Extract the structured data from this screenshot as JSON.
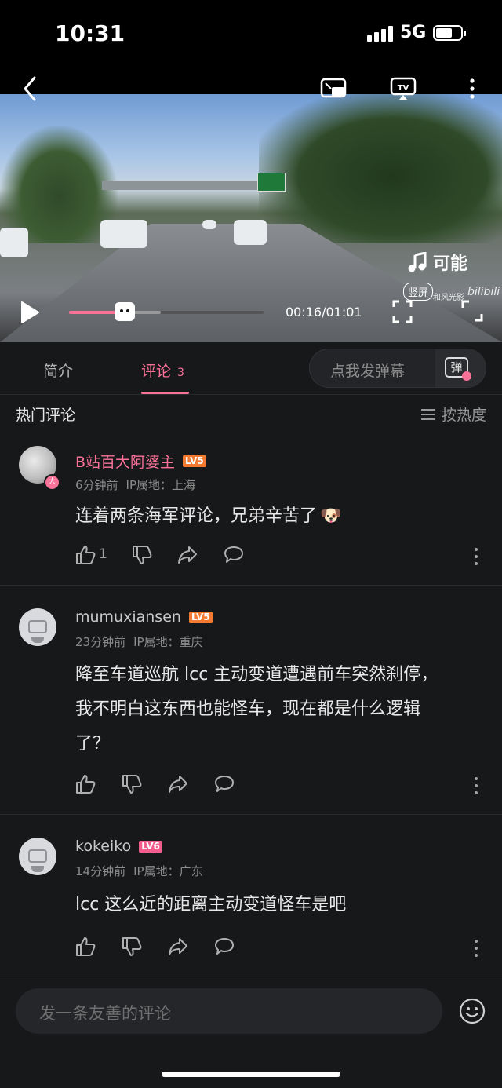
{
  "status_bar": {
    "time": "10:31",
    "network": "5G"
  },
  "video": {
    "music_label": "可能",
    "vertical_label": "竖屏",
    "watermark": "和风光影",
    "watermark_logo": "bilibili",
    "timecode": "00:16/01:01",
    "progress_fraction": 0.24,
    "buffer_fraction": 0.47
  },
  "tabs": {
    "intro_label": "简介",
    "comments_label": "评论",
    "comments_count": "3",
    "danmaku_placeholder": "点我发弹幕",
    "danmaku_icon_label": "弹"
  },
  "section": {
    "title": "热门评论",
    "sort_label": "按热度"
  },
  "comments": [
    {
      "username": "B站百大阿婆主",
      "level": "LV5",
      "time": "6分钟前",
      "ip": "IP属地：上海",
      "text": "连着两条海军评论，兄弟辛苦了",
      "emoji": "🐶",
      "like_count": "1",
      "badge": "大"
    },
    {
      "username": "mumuxiansen",
      "level": "LV5",
      "time": "23分钟前",
      "ip": "IP属地：重庆",
      "text_lines": [
        "降至车道巡航 lcc 主动变道遭遇前车突然刹停，",
        "我不明白这东西也能怪车，现在都是什么逻辑",
        "了？"
      ]
    },
    {
      "username": "kokeiko",
      "level": "LV6",
      "time": "14分钟前",
      "ip": "IP属地：广东",
      "text": "lcc 这么近的距离主动变道怪车是吧"
    }
  ],
  "composer": {
    "placeholder": "发一条友善的评论"
  },
  "colors": {
    "accent": "#fb7299",
    "background": "#17181a",
    "level5": "#f47a33",
    "level6": "#f25d8e"
  }
}
